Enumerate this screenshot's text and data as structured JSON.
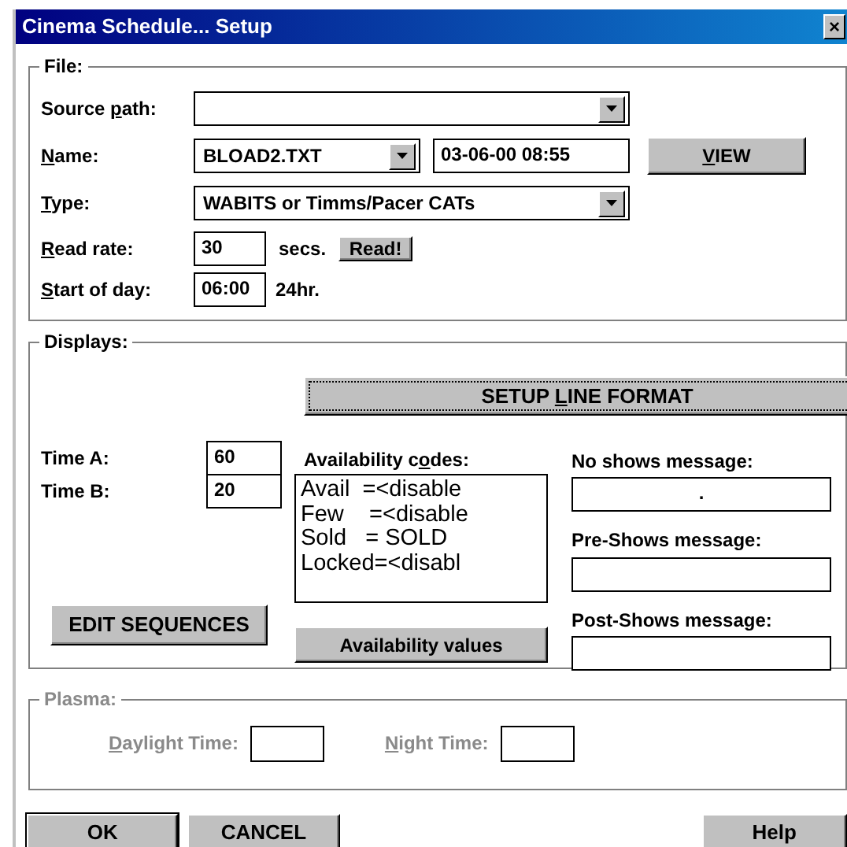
{
  "window": {
    "title": "Cinema Schedule... Setup",
    "close": "×"
  },
  "file": {
    "legend": "File:",
    "source_path": {
      "label": [
        {
          "t": "Source "
        },
        {
          "t": "p",
          "u": true
        },
        {
          "t": "ath:"
        }
      ]
    },
    "name": {
      "label": [
        {
          "t": "N",
          "u": true
        },
        {
          "t": "ame:"
        }
      ],
      "value": "BLOAD2.TXT",
      "timestamp": "03-06-00 08:55"
    },
    "view_button": [
      {
        "t": "V",
        "u": true
      },
      {
        "t": "IEW"
      }
    ],
    "type": {
      "label": [
        {
          "t": "T",
          "u": true
        },
        {
          "t": "ype:"
        }
      ],
      "value": "WABITS or Timms/Pacer CATs"
    },
    "read_rate": {
      "label": [
        {
          "t": "R",
          "u": true
        },
        {
          "t": "ead rate:"
        }
      ],
      "value": "30",
      "unit": "secs.",
      "button": "Read!"
    },
    "start_of_day": {
      "label": [
        {
          "t": "S",
          "u": true
        },
        {
          "t": "tart of day:"
        }
      ],
      "value": "06:00",
      "unit": "24hr."
    }
  },
  "displays": {
    "legend": "Displays:",
    "setup_button": [
      {
        "t": "SETUP "
      },
      {
        "t": "L",
        "u": true
      },
      {
        "t": "INE FORMAT"
      }
    ],
    "time_a": {
      "label": "Time A:",
      "value": "60"
    },
    "time_b": {
      "label": "Time B:",
      "value": "20"
    },
    "edit_button": "EDIT SEQUENCES",
    "availability": {
      "label": [
        {
          "t": "Availability c"
        },
        {
          "t": "o",
          "u": true
        },
        {
          "t": "des:"
        }
      ],
      "items": [
        "Avail  =<disable",
        "Few    =<disable",
        "Sold   = SOLD",
        "Locked=<disabl"
      ],
      "button": "Availability values"
    },
    "messages": [
      {
        "label": "No shows message:",
        "value": "."
      },
      {
        "label": "Pre-Shows message:"
      },
      {
        "label": "Post-Shows message:"
      }
    ]
  },
  "plasma": {
    "legend": "Plasma:",
    "disabled": true,
    "fields": [
      {
        "label": [
          {
            "t": "D",
            "u": true
          },
          {
            "t": "aylight Time:"
          }
        ]
      },
      {
        "label": [
          {
            "t": "N",
            "u": true
          },
          {
            "t": "ight Time:"
          }
        ]
      }
    ]
  },
  "buttons": [
    {
      "label": "OK",
      "default": true
    },
    {
      "label": "CANCEL",
      "default": false
    },
    {
      "label": "Help",
      "default": false
    }
  ]
}
